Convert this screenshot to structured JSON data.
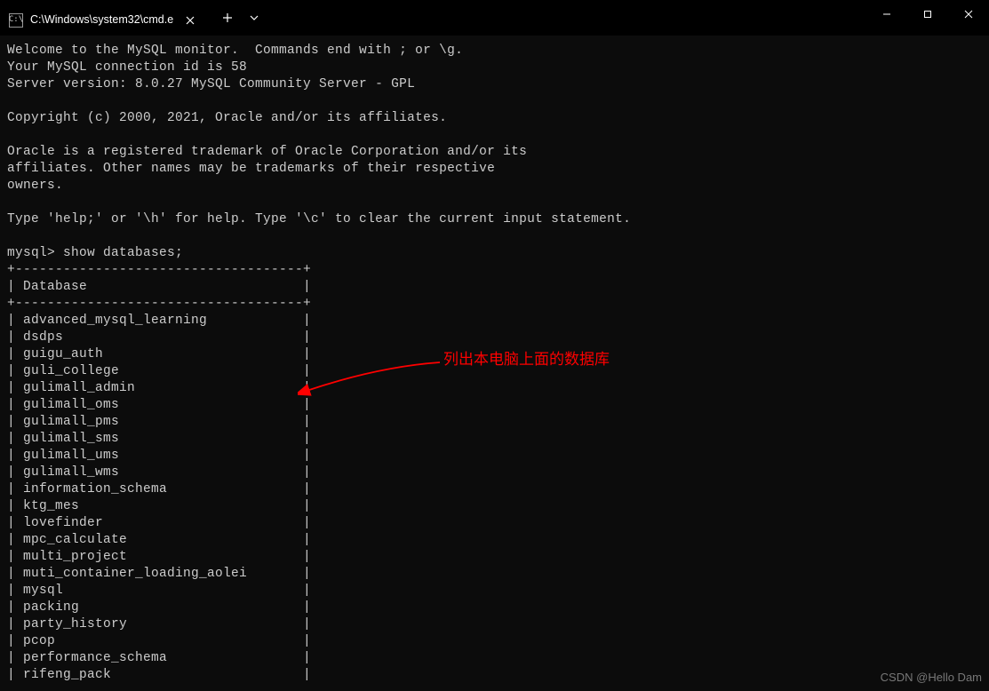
{
  "tab": {
    "title": "C:\\Windows\\system32\\cmd.e"
  },
  "terminal": {
    "banner": [
      "Welcome to the MySQL monitor.  Commands end with ; or \\g.",
      "Your MySQL connection id is 58",
      "Server version: 8.0.27 MySQL Community Server - GPL",
      "",
      "Copyright (c) 2000, 2021, Oracle and/or its affiliates.",
      "",
      "Oracle is a registered trademark of Oracle Corporation and/or its",
      "affiliates. Other names may be trademarks of their respective",
      "owners.",
      "",
      "Type 'help;' or '\\h' for help. Type '\\c' to clear the current input statement.",
      ""
    ],
    "prompt": "mysql> ",
    "command": "show databases;",
    "table_border": "+------------------------------------+",
    "table_header": "| Database                           |",
    "databases": [
      "advanced_mysql_learning",
      "dsdps",
      "guigu_auth",
      "guli_college",
      "gulimall_admin",
      "gulimall_oms",
      "gulimall_pms",
      "gulimall_sms",
      "gulimall_ums",
      "gulimall_wms",
      "information_schema",
      "ktg_mes",
      "lovefinder",
      "mpc_calculate",
      "multi_project",
      "muti_container_loading_aolei",
      "mysql",
      "packing",
      "party_history",
      "pcop",
      "performance_schema",
      "rifeng_pack"
    ]
  },
  "annotation": {
    "text": "列出本电脑上面的数据库"
  },
  "watermark": {
    "text": "CSDN @Hello Dam"
  }
}
